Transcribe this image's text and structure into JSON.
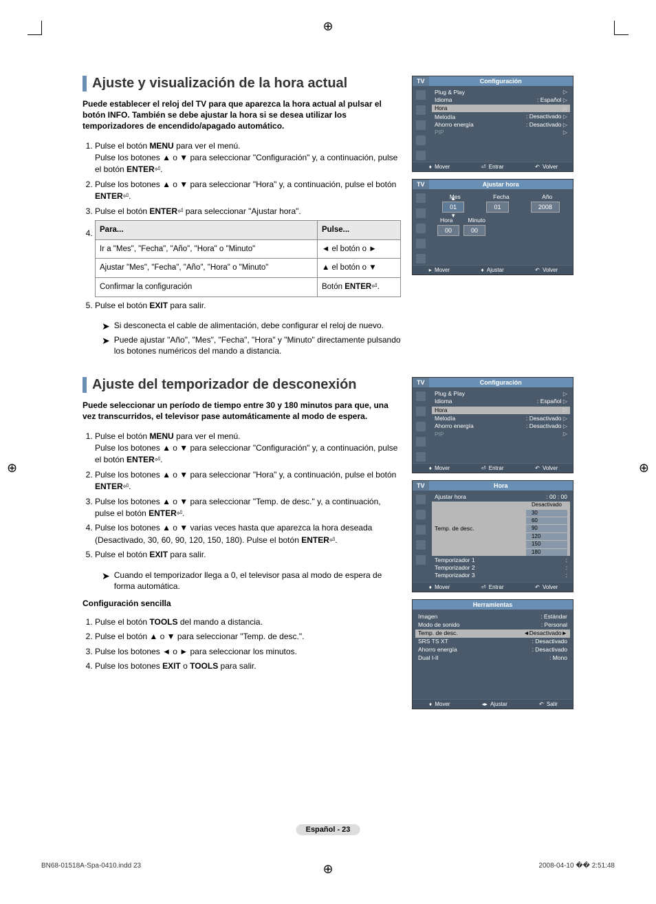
{
  "section1": {
    "title": "Ajuste y visualización de la hora actual",
    "intro": "Puede establecer el reloj del TV para que aparezca la hora actual al pulsar el botón INFO. También se debe ajustar la hora si se desea utilizar los temporizadores de encendido/apagado automático.",
    "s1a": "Pulse el botón ",
    "s1b": "MENU",
    "s1c": " para ver el menú.",
    "s1d": "Pulse los botones ▲ o ▼ para seleccionar \"Configuración\" y, a continuación, pulse el botón ",
    "s1e": "ENTER",
    "s1f": ".",
    "s2a": "Pulse los botones ▲ o ▼ para seleccionar \"Hora\" y, a continuación, pulse el botón ",
    "s2b": "ENTER",
    "s2c": ".",
    "s3a": "Pulse el botón ",
    "s3b": "ENTER",
    "s3c": " para seleccionar \"Ajustar hora\".",
    "th1": "Para...",
    "th2": "Pulse...",
    "r1a": "Ir a \"Mes\", \"Fecha\", \"Año\", \"Hora\" o \"Minuto\"",
    "r1b": "◄ el botón o ►",
    "r2a": "Ajustar \"Mes\", \"Fecha\", \"Año\", \"Hora\" o \"Minuto\"",
    "r2b": "▲ el botón o ▼",
    "r3a": "Confirmar la configuración",
    "r3b": "Botón ",
    "r3c": "ENTER",
    "r3d": ".",
    "s5a": "Pulse el botón ",
    "s5b": "EXIT",
    "s5c": " para salir.",
    "n1": "Si desconecta el cable de alimentación, debe configurar el reloj de nuevo.",
    "n2": "Puede ajustar \"Año\", \"Mes\", \"Fecha\", \"Hora\" y \"Minuto\" directamente pulsando los botones numéricos del mando a distancia."
  },
  "section2": {
    "title": "Ajuste del temporizador de desconexión",
    "intro": "Puede seleccionar un período de tiempo entre 30 y 180 minutos para que, una vez transcurridos, el televisor pase automáticamente al modo de espera.",
    "s1a": "Pulse el botón ",
    "s1b": "MENU",
    "s1c": " para ver el menú.",
    "s1d": "Pulse los botones ▲ o ▼ para seleccionar \"Configuración\" y, a continuación, pulse el botón ",
    "s1e": "ENTER",
    "s1f": ".",
    "s2a": "Pulse los botones ▲ o ▼ para seleccionar \"Hora\" y, a continuación, pulse el botón ",
    "s2b": "ENTER",
    "s2c": ".",
    "s3a": "Pulse los botones ▲ o ▼ para seleccionar \"Temp. de desc.\" y, a continuación, pulse el botón ",
    "s3b": "ENTER",
    "s3c": ".",
    "s4a": "Pulse los botones ▲ o ▼ varias veces hasta que aparezca la hora deseada (Desactivado, 30, 60, 90, 120, 150, 180). Pulse el botón ",
    "s4b": "ENTER",
    "s4c": ".",
    "s5a": "Pulse el botón ",
    "s5b": "EXIT",
    "s5c": " para salir.",
    "n1": "Cuando el temporizador llega a 0, el televisor pasa al modo de espera de forma automática.",
    "easy_h": "Configuración sencilla",
    "e1a": "Pulse el botón ",
    "e1b": "TOOLS",
    "e1c": " del mando a distancia.",
    "e2": "Pulse el botón ▲ o ▼ para seleccionar \"Temp. de desc.\".",
    "e3": "Pulse los botones ◄ o ► para seleccionar los minutos.",
    "e4a": "Pulse los botones ",
    "e4b": "EXIT",
    "e4c": " o ",
    "e4d": "TOOLS",
    "e4e": " para salir."
  },
  "osd": {
    "tv": "TV",
    "conf": "Configuración",
    "ajustar": "Ajustar hora",
    "hora": "Hora",
    "herr": "Herramientas",
    "plug": "Plug & Play",
    "idioma": "Idioma",
    "horaL": "Hora",
    "melodia": "Melodía",
    "ahorro": "Ahorro energía",
    "pip": "PIP",
    "esp": ": Español",
    "des": ": Desactivado",
    "mover": "Mover",
    "entrar": "Entrar",
    "volver": "Volver",
    "ajustarF": "Ajustar",
    "salir": "Salir",
    "mes": "Mes",
    "fecha": "Fecha",
    "ano": "Año",
    "horaC": "Hora",
    "minuto": "Minuto",
    "v01": "01",
    "v2008": "2008",
    "v00": "00",
    "ajhora": "Ajustar hora",
    "tdesc": "Temp. de desc.",
    "t1": "Temporizador 1",
    "t2": "Temporizador 2",
    "t3": "Temporizador 3",
    "v0000": ": 00 : 00",
    "desact": "Desactivado",
    "o30": "30",
    "o60": "60",
    "o90": "90",
    "o120": "120",
    "o150": "150",
    "o180": "180",
    "imagen": "Imagen",
    "modo": "Modo de sonido",
    "srs": "SRS TS XT",
    "dual": "Dual I-II",
    "vest": ": Estándar",
    "vper": ": Personal",
    "vdes": ": Desactivado",
    "vmono": ": Mono",
    "tdescT": "Temp. de desc.",
    "tdescV": "Desactivado"
  },
  "footer": {
    "page": "Español - 23",
    "file": "BN68-01518A-Spa-0410.indd   23",
    "time": "2008-04-10   �� 2:51:48"
  }
}
